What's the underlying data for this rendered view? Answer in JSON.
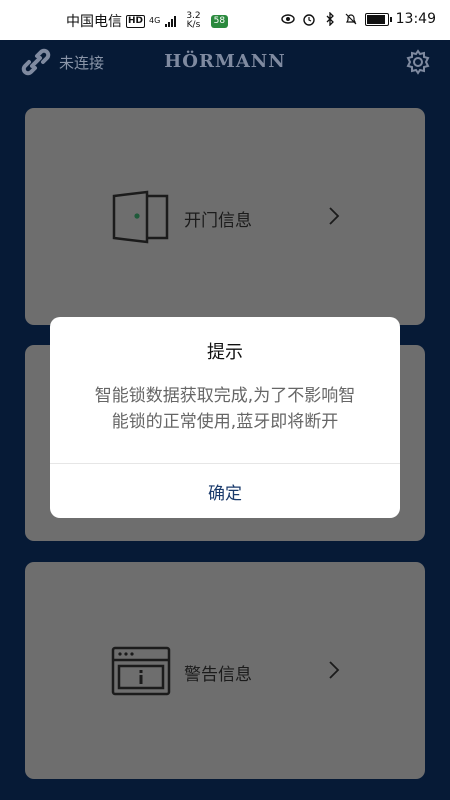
{
  "status_bar": {
    "carrier": "中国电信",
    "hd": "HD",
    "network": "4G",
    "speed_value": "3.2",
    "speed_unit": "K/s",
    "badge": "58",
    "time": "13:49",
    "battery_level": 0.85
  },
  "header": {
    "connection_status": "未连接",
    "brand": "HÖRMANN"
  },
  "cards": [
    {
      "label": "开门信息",
      "icon": "door-icon"
    },
    {
      "label": "",
      "icon": ""
    },
    {
      "label": "警告信息",
      "icon": "warning-window-icon"
    }
  ],
  "dialog": {
    "title": "提示",
    "message_line1": "智能锁数据获取完成,为了不影响智",
    "message_line2": "能锁的正常使用,蓝牙即将断开",
    "confirm": "确定"
  },
  "colors": {
    "background": "#061a36",
    "card": "#6e6e6e",
    "dialog_button": "#1a3a6b"
  }
}
